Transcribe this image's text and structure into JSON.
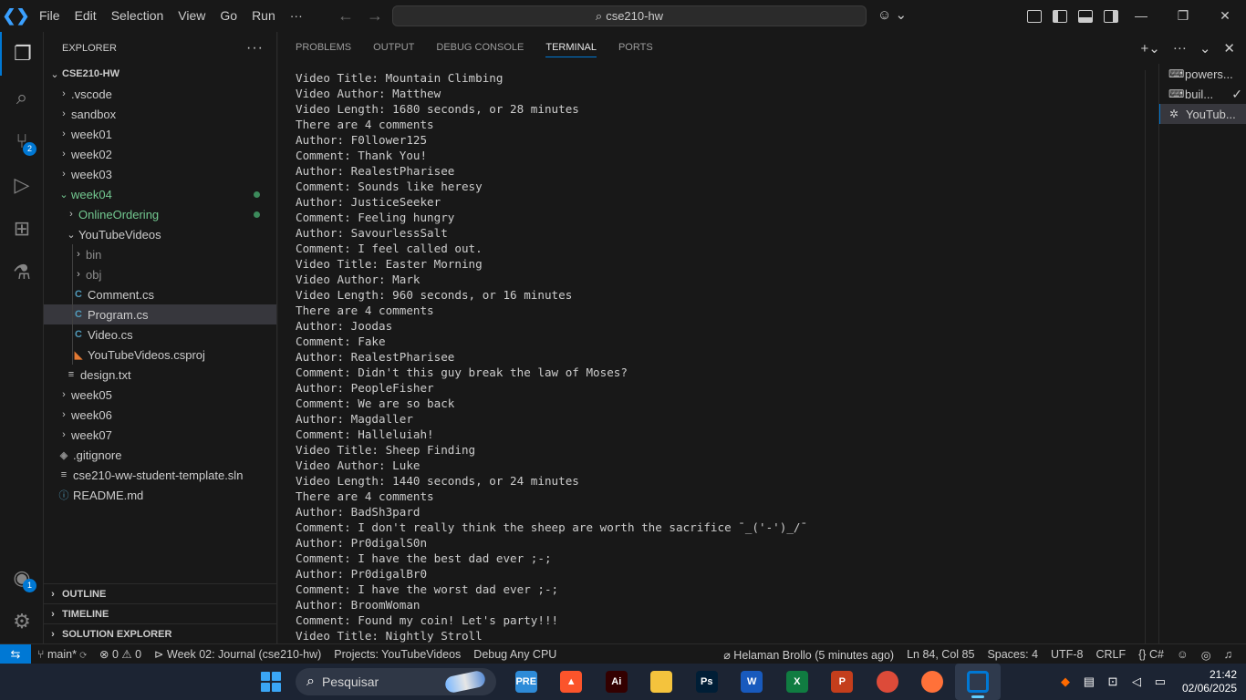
{
  "titlebar": {
    "menu": [
      "File",
      "Edit",
      "Selection",
      "View",
      "Go",
      "Run",
      "···"
    ],
    "search_text": "cse210-hw"
  },
  "activity": {
    "source_control_badge": "2",
    "accounts_badge": "1"
  },
  "explorer": {
    "header": "EXPLORER",
    "more": "···",
    "root": "CSE210-HW",
    "items": [
      {
        "label": ".vscode"
      },
      {
        "label": "sandbox"
      },
      {
        "label": "week01"
      },
      {
        "label": "week02"
      },
      {
        "label": "week03"
      },
      {
        "label": "week04"
      },
      {
        "label": "OnlineOrdering"
      },
      {
        "label": "YouTubeVideos"
      },
      {
        "label": "bin"
      },
      {
        "label": "obj"
      },
      {
        "label": "Comment.cs"
      },
      {
        "label": "Program.cs"
      },
      {
        "label": "Video.cs"
      },
      {
        "label": "YouTubeVideos.csproj"
      },
      {
        "label": "design.txt"
      },
      {
        "label": "week05"
      },
      {
        "label": "week06"
      },
      {
        "label": "week07"
      },
      {
        "label": ".gitignore"
      },
      {
        "label": "cse210-ww-student-template.sln"
      },
      {
        "label": "README.md"
      }
    ],
    "bottom_panels": [
      "OUTLINE",
      "TIMELINE",
      "SOLUTION EXPLORER"
    ]
  },
  "panel": {
    "tabs": [
      "PROBLEMS",
      "OUTPUT",
      "DEBUG CONSOLE",
      "TERMINAL",
      "PORTS"
    ],
    "active_tab": "TERMINAL",
    "terminals": [
      "powers...",
      "buil...",
      "YouTub..."
    ]
  },
  "terminal_lines": [
    "Video Title: Mountain Climbing",
    "Video Author: Matthew",
    "Video Length: 1680 seconds, or 28 minutes",
    "There are 4 comments",
    "Author: F0llower125",
    "Comment: Thank You!",
    "Author: RealestPharisee",
    "Comment: Sounds like heresy",
    "Author: JusticeSeeker",
    "Comment: Feeling hungry",
    "Author: SavourlessSalt",
    "Comment: I feel called out.",
    "Video Title: Easter Morning",
    "Video Author: Mark",
    "Video Length: 960 seconds, or 16 minutes",
    "There are 4 comments",
    "Author: Joodas",
    "Comment: Fake",
    "Author: RealestPharisee",
    "Comment: Didn't this guy break the law of Moses?",
    "Author: PeopleFisher",
    "Comment: We are so back",
    "Author: Magdaller",
    "Comment: Halleluiah!",
    "Video Title: Sheep Finding",
    "Video Author: Luke",
    "Video Length: 1440 seconds, or 24 minutes",
    "There are 4 comments",
    "Author: BadSh3pard",
    "Comment: I don't really think the sheep are worth the sacrifice ¯_('-')_/¯",
    "Author: Pr0digalS0n",
    "Comment: I have the best dad ever ;-;",
    "Author: Pr0digalBr0",
    "Comment: I have the worst dad ever ;-;",
    "Author: BroomWoman",
    "Comment: Found my coin! Let's party!!!",
    "Video Title: Nightly Stroll"
  ],
  "statusbar": {
    "branch": "main*",
    "errors": "0",
    "warnings": "0",
    "launch": "Week 02: Journal (cse210-hw)",
    "projects": "Projects: YouTubeVideos",
    "debug": "Debug Any CPU",
    "blame": "Helaman Brollo (5 minutes ago)",
    "position": "Ln 84, Col 85",
    "spaces": "Spaces: 4",
    "encoding": "UTF-8",
    "eol": "CRLF",
    "language": "C#"
  },
  "taskbar": {
    "search_placeholder": "Pesquisar",
    "time": "21:42",
    "date": "02/06/2025",
    "apps": [
      {
        "name": "copilot-icon",
        "text": "PRE",
        "color": "#2e8bd8"
      },
      {
        "name": "brave-icon",
        "text": "▲",
        "color": "#fb542b"
      },
      {
        "name": "illustrator-icon",
        "text": "Ai",
        "color": "#330000"
      },
      {
        "name": "file-explorer-icon",
        "text": "",
        "color": "#f4c33d"
      },
      {
        "name": "photoshop-icon",
        "text": "Ps",
        "color": "#001e36"
      },
      {
        "name": "word-icon",
        "text": "W",
        "color": "#185abd"
      },
      {
        "name": "excel-icon",
        "text": "X",
        "color": "#107c41"
      },
      {
        "name": "powerpoint-icon",
        "text": "P",
        "color": "#c43e1c"
      },
      {
        "name": "chrome-icon",
        "text": "",
        "color": "#dd4b39"
      },
      {
        "name": "firefox-icon",
        "text": "",
        "color": "#ff7139"
      },
      {
        "name": "vscode-icon",
        "text": "",
        "color": "#0078d4"
      }
    ]
  }
}
